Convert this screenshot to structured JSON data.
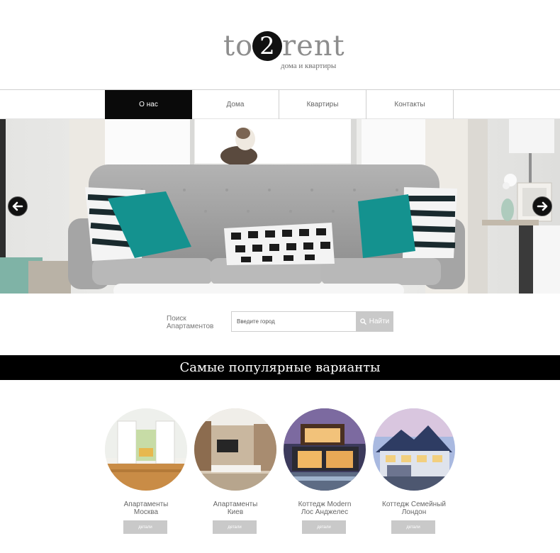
{
  "logo": {
    "part1": "to",
    "digit": "2",
    "part2": "rent",
    "tagline": "дома и квартиры"
  },
  "nav": [
    {
      "label": "О нас",
      "active": true
    },
    {
      "label": "Дома",
      "active": false
    },
    {
      "label": "Квартиры",
      "active": false
    },
    {
      "label": "Контакты",
      "active": false
    }
  ],
  "hero": {
    "prev_icon": "arrow-left-icon",
    "next_icon": "arrow-right-icon"
  },
  "search": {
    "label_line1": "Поиск",
    "label_line2": "Апартаментов",
    "placeholder": "Введите город",
    "button_label": "Найти",
    "button_icon": "search-icon"
  },
  "popular": {
    "heading": "Самые популярные варианты"
  },
  "cards": [
    {
      "line1": "Апартаменты",
      "line2": "Москва",
      "button": "детали"
    },
    {
      "line1": "Апартаменты",
      "line2": "Киев",
      "button": "детали"
    },
    {
      "line1": "Коттедж Modern",
      "line2": "Лос Анджелес",
      "button": "детали"
    },
    {
      "line1": "Коттедж Семейный",
      "line2": "Лондон",
      "button": "детали"
    }
  ],
  "colors": {
    "accent": "#000000",
    "button_gray": "#c9c9c9",
    "teal_pillow": "#14928f"
  }
}
